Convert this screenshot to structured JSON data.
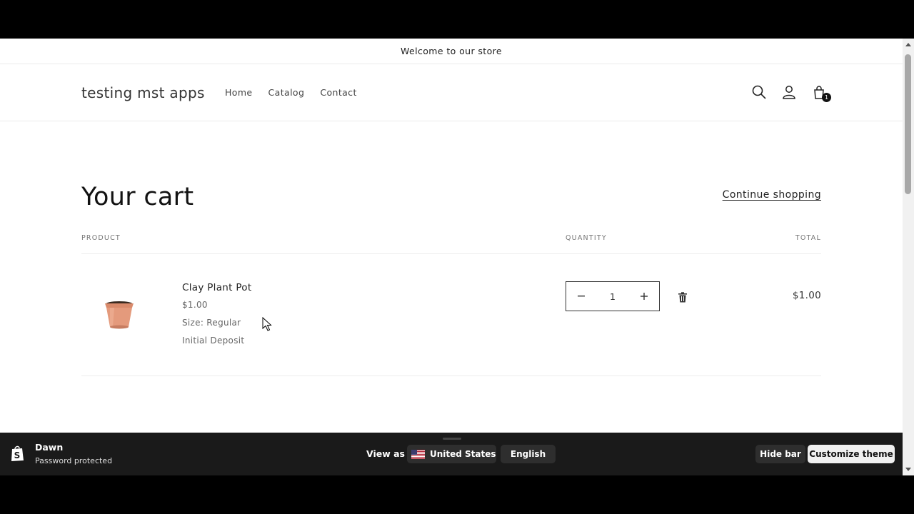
{
  "announcement": {
    "text": "Welcome to our store"
  },
  "header": {
    "logo": "testing mst apps",
    "nav": [
      {
        "label": "Home"
      },
      {
        "label": "Catalog"
      },
      {
        "label": "Contact"
      }
    ],
    "icons": [
      "search-icon",
      "account-icon",
      "cart-icon"
    ],
    "cart_count": "1"
  },
  "cart": {
    "title": "Your cart",
    "continue_label": "Continue shopping",
    "columns": {
      "product": "PRODUCT",
      "quantity": "QUANTITY",
      "total": "TOTAL"
    },
    "items": [
      {
        "name": "Clay Plant Pot",
        "price": "$1.00",
        "size": "Size: Regular",
        "plan": "Initial Deposit",
        "quantity": "1",
        "total": "$1.00",
        "image_icon": "clay-pot-image"
      }
    ]
  },
  "preview_bar": {
    "theme_name": "Dawn",
    "status": "Password protected",
    "view_as_label": "View as",
    "country": "United States",
    "language": "English",
    "hide_label": "Hide bar",
    "customize_label": "Customize theme"
  },
  "colors": {
    "text": "#121212",
    "border": "#ececec",
    "preview_bar_bg": "#1a1a1a",
    "cart_badge": "#121212"
  }
}
